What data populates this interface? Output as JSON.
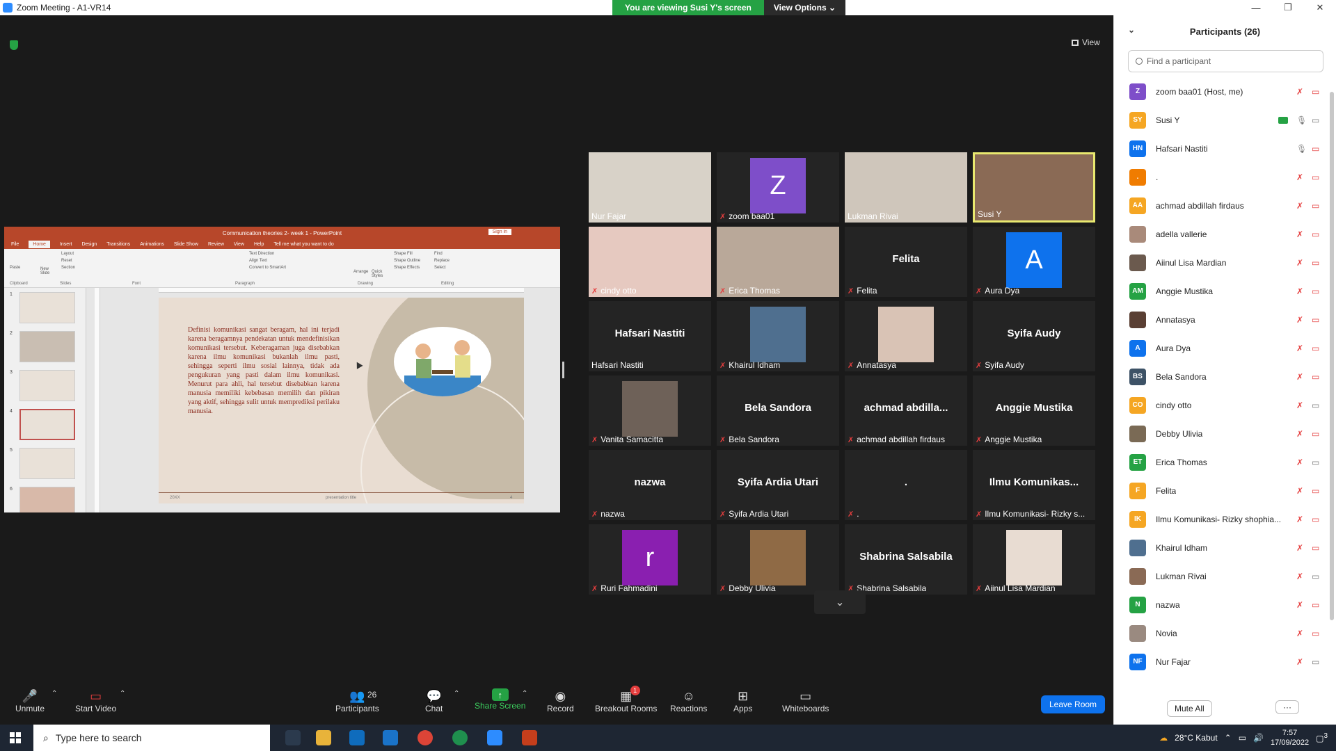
{
  "window": {
    "title": "Zoom Meeting - A1-VR14"
  },
  "banner": {
    "viewing": "You are viewing Susi Y's screen",
    "view_options": "View Options ⌄"
  },
  "view_button": "View",
  "ppt": {
    "title": "Communication theories 2- week 1 - PowerPoint",
    "signin": "Sign in",
    "tabs": [
      "File",
      "Home",
      "Insert",
      "Design",
      "Transitions",
      "Animations",
      "Slide Show",
      "Review",
      "View",
      "Help"
    ],
    "tell_me": "Tell me what you want to do",
    "groups": [
      "Clipboard",
      "Slides",
      "Font",
      "Paragraph",
      "Drawing",
      "Editing"
    ],
    "ribbon": {
      "paste": "Paste",
      "new_slide": "New Slide",
      "layout": "Layout",
      "reset": "Reset",
      "section": "Section",
      "text_direction": "Text Direction",
      "align_text": "Align Text",
      "convert": "Convert to SmartArt",
      "arrange": "Arrange",
      "quick_styles": "Quick Styles",
      "shape_fill": "Shape Fill",
      "shape_outline": "Shape Outline",
      "shape_effects": "Shape Effects",
      "find": "Find",
      "replace": "Replace",
      "select": "Select"
    },
    "slide_numbers": [
      "1",
      "2",
      "3",
      "4",
      "5",
      "6"
    ],
    "slide_text": "Definisi komunikasi sangat beragam, hal ini terjadi karena beragamnya pendekatan untuk mendefinisikan komunikasi tersebut. Keberagaman juga disebabkan karena ilmu komunikasi bukanlah ilmu pasti, sehingga seperti ilmu sosial lainnya, tidak ada pengukuran yang pasti dalam ilmu komunikasi. Menurut para ahli, hal tersebut disebabkan karena manusia memiliki kebebasan memilih dan pikiran yang aktif, sehingga sulit untuk memprediksi perilaku manusia.",
    "footer_left": "20XX",
    "footer_center": "presentation title",
    "footer_right": "4"
  },
  "tiles": [
    {
      "name": "Nur Fajar",
      "kind": "video",
      "muted": false,
      "color": "#d8d2c8"
    },
    {
      "name": "zoom baa01",
      "kind": "avatar",
      "letter": "Z",
      "color": "#7e4ec9",
      "muted": true
    },
    {
      "name": "Lukman Rivai",
      "kind": "video",
      "muted": false,
      "color": "#cfc6bb"
    },
    {
      "name": "Susi Y",
      "kind": "video",
      "muted": false,
      "color": "#8a6a55",
      "active": true
    },
    {
      "name": "cindy otto",
      "kind": "video",
      "muted": true,
      "color": "#e6c9c0"
    },
    {
      "name": "Erica Thomas",
      "kind": "video",
      "muted": true,
      "color": "#b9a899"
    },
    {
      "name": "Felita",
      "kind": "text",
      "muted": true
    },
    {
      "name": "Aura Dya",
      "kind": "avatar",
      "letter": "A",
      "color": "#0e72ed",
      "muted": true
    },
    {
      "name": "Hafsari Nastiti",
      "kind": "text",
      "muted": false
    },
    {
      "name": "Khairul Idham",
      "kind": "photo",
      "muted": true,
      "color": "#4f6f8f"
    },
    {
      "name": "Annatasya",
      "kind": "photo",
      "muted": true,
      "color": "#d9c3b5"
    },
    {
      "name": "Syifa Audy",
      "kind": "text",
      "muted": true
    },
    {
      "name": "Vanita Samacitta",
      "kind": "photo",
      "muted": true,
      "color": "#6e6158"
    },
    {
      "name": "Bela Sandora",
      "kind": "text",
      "muted": true
    },
    {
      "name": "achmad abdillah firdaus",
      "big": "achmad  abdilla...",
      "kind": "text",
      "muted": true
    },
    {
      "name": "Anggie Mustika",
      "kind": "text",
      "muted": true
    },
    {
      "name": "nazwa",
      "kind": "text",
      "muted": true
    },
    {
      "name": "Syifa Ardia Utari",
      "kind": "text",
      "muted": true
    },
    {
      "name": ".",
      "kind": "text",
      "muted": true
    },
    {
      "name": "Ilmu Komunikasi- Rizky s...",
      "big": "Ilmu Komunikas...",
      "kind": "text",
      "muted": true
    },
    {
      "name": "Ruri Fahmadini",
      "kind": "avatar",
      "letter": "r",
      "color": "#8a1fb0",
      "muted": true
    },
    {
      "name": "Debby Ulivia",
      "kind": "photo",
      "muted": true,
      "color": "#8f6a45"
    },
    {
      "name": "Shabrina Salsabila",
      "kind": "text",
      "muted": true
    },
    {
      "name": "Aiinul Lisa Mardian",
      "kind": "photo",
      "muted": true,
      "color": "#e8dcd2"
    }
  ],
  "toolbar": {
    "unmute": "Unmute",
    "start_video": "Start Video",
    "participants": "Participants",
    "participants_count": "26",
    "chat": "Chat",
    "share_screen": "Share Screen",
    "record": "Record",
    "breakout": "Breakout Rooms",
    "breakout_badge": "1",
    "reactions": "Reactions",
    "apps": "Apps",
    "whiteboards": "Whiteboards",
    "leave": "Leave Room"
  },
  "panel": {
    "title": "Participants (26)",
    "search_placeholder": "Find a participant",
    "mute_all": "Mute All",
    "more": "···",
    "participants": [
      {
        "initials": "Z",
        "name": "zoom baa01 (Host, me)",
        "color": "#7e4ec9",
        "mic": "off",
        "cam": "off"
      },
      {
        "initials": "SY",
        "name": "Susi Y",
        "color": "#f5a623",
        "mic": "on",
        "cam": "on",
        "sharing": true
      },
      {
        "initials": "HN",
        "name": "Hafsari Nastiti",
        "color": "#0e72ed",
        "mic": "on",
        "cam": "off"
      },
      {
        "initials": ".",
        "name": ".",
        "color": "#f07c00",
        "mic": "off",
        "cam": "off"
      },
      {
        "initials": "AA",
        "name": "achmad abdillah firdaus",
        "color": "#f5a623",
        "mic": "off",
        "cam": "off"
      },
      {
        "initials": "",
        "name": "adella vallerie",
        "color": "#a98a7a",
        "mic": "off",
        "cam": "off"
      },
      {
        "initials": "",
        "name": "Aiinul Lisa Mardian",
        "color": "#6b5a4e",
        "mic": "off",
        "cam": "off"
      },
      {
        "initials": "AM",
        "name": "Anggie Mustika",
        "color": "#25a244",
        "mic": "off",
        "cam": "off"
      },
      {
        "initials": "",
        "name": "Annatasya",
        "color": "#5a3f33",
        "mic": "off",
        "cam": "off"
      },
      {
        "initials": "A",
        "name": "Aura Dya",
        "color": "#0e72ed",
        "mic": "off",
        "cam": "off"
      },
      {
        "initials": "BS",
        "name": "Bela Sandora",
        "color": "#3d5266",
        "mic": "off",
        "cam": "off"
      },
      {
        "initials": "CO",
        "name": "cindy otto",
        "color": "#f5a623",
        "mic": "off",
        "cam": "on"
      },
      {
        "initials": "",
        "name": "Debby Ulivia",
        "color": "#7a6a55",
        "mic": "off",
        "cam": "off"
      },
      {
        "initials": "ET",
        "name": "Erica Thomas",
        "color": "#25a244",
        "mic": "off",
        "cam": "on"
      },
      {
        "initials": "F",
        "name": "Felita",
        "color": "#f5a623",
        "mic": "off",
        "cam": "off"
      },
      {
        "initials": "IK",
        "name": "Ilmu Komunikasi- Rizky shophia...",
        "color": "#f5a623",
        "mic": "off",
        "cam": "off"
      },
      {
        "initials": "",
        "name": "Khairul Idham",
        "color": "#4f6f8f",
        "mic": "off",
        "cam": "off"
      },
      {
        "initials": "",
        "name": "Lukman Rivai",
        "color": "#8a6a55",
        "mic": "off",
        "cam": "on"
      },
      {
        "initials": "N",
        "name": "nazwa",
        "color": "#25a244",
        "mic": "off",
        "cam": "off"
      },
      {
        "initials": "",
        "name": "Novia",
        "color": "#9a8a80",
        "mic": "off",
        "cam": "off"
      },
      {
        "initials": "NF",
        "name": "Nur Fajar",
        "color": "#0e72ed",
        "mic": "off",
        "cam": "on"
      }
    ]
  },
  "taskbar": {
    "search": "Type here to search",
    "weather": "28°C  Kabut",
    "time": "7:57",
    "date": "17/09/2022",
    "notif": "3"
  }
}
